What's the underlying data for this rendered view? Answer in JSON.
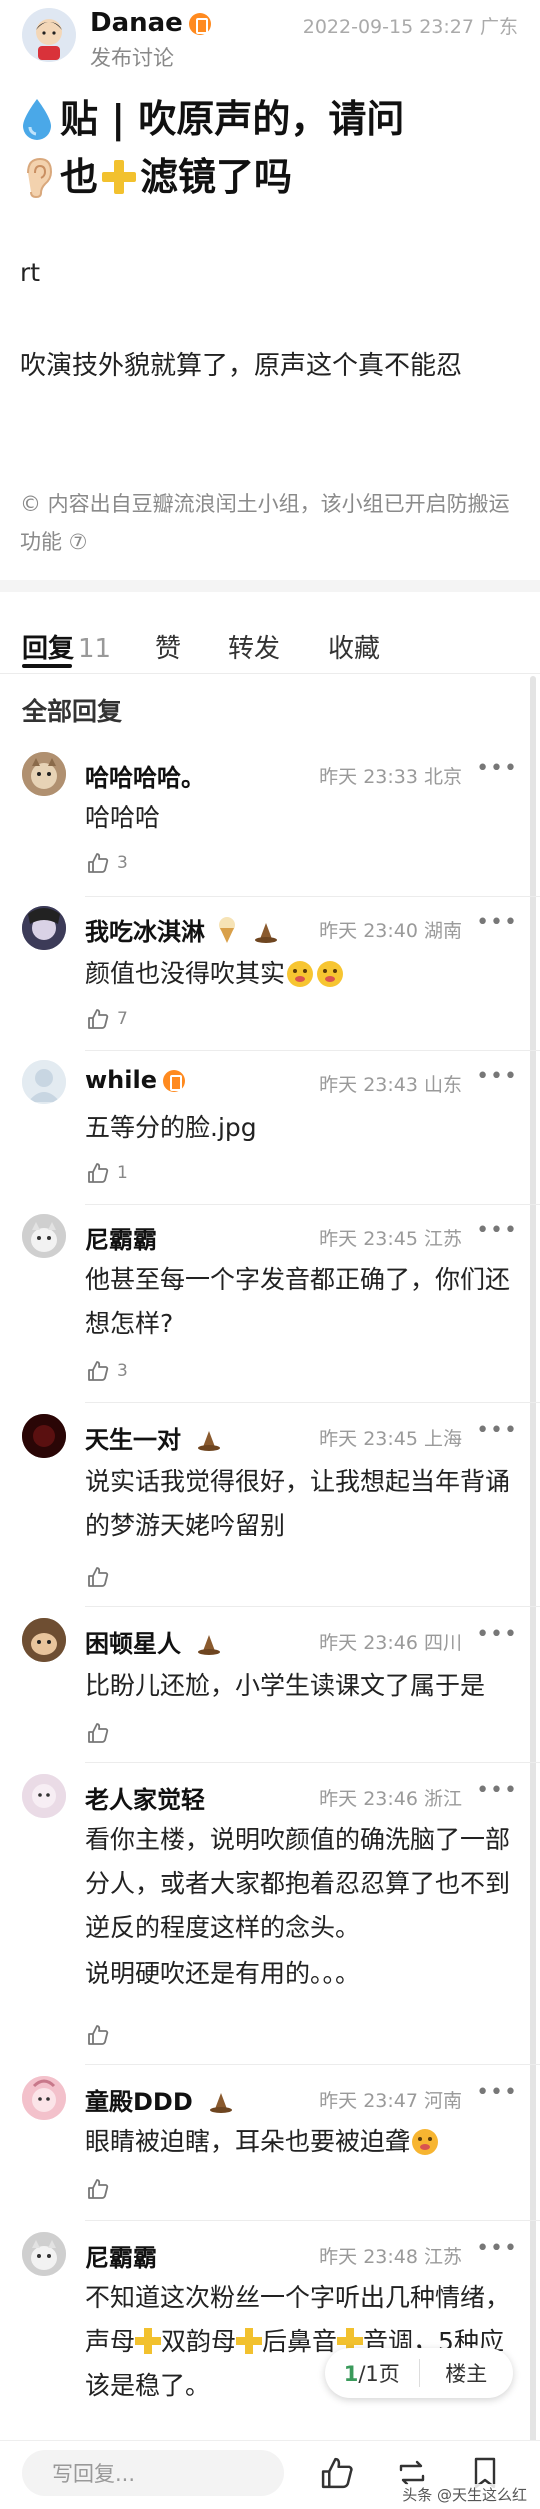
{
  "post": {
    "author": "Danae",
    "subtitle": "发布讨论",
    "timestamp": "2022-09-15 23:27 广东",
    "title_line1": "贴 | 吹原声的，请问",
    "title_line2_a": "也",
    "title_line2_b": "滤镜了吗",
    "body_p1": "rt",
    "body_p2": "吹演技外貌就算了，原声这个真不能忍",
    "source_note": "© 内容出自豆瓣流浪闰土小组，该小组已开启防搬运功能 ⑦"
  },
  "tabs": {
    "reply": "回复",
    "reply_count": "11",
    "like": "赞",
    "forward": "转发",
    "collect": "收藏"
  },
  "section_title": "全部回复",
  "comments": [
    {
      "name": "哈哈哈哈。",
      "meta": "昨天 23:33 北京",
      "text": "哈哈哈",
      "likes": "3"
    },
    {
      "name": "我吃冰淇淋",
      "meta": "昨天 23:40 湖南",
      "text": "颜值也没得吹其实",
      "likes": "7"
    },
    {
      "name": "while",
      "meta": "昨天 23:43 山东",
      "text": "五等分的脸.jpg",
      "likes": "1"
    },
    {
      "name": "尼霸霸",
      "meta": "昨天 23:45 江苏",
      "text": "他甚至每一个字发音都正确了，你们还想怎样?",
      "likes": "3"
    },
    {
      "name": "天生一对",
      "meta": "昨天 23:45 上海",
      "text": "说实话我觉得很好，让我想起当年背诵的梦游天姥吟留别",
      "likes": ""
    },
    {
      "name": "困顿星人",
      "meta": "昨天 23:46 四川",
      "text": "比盼儿还尬，小学生读课文了属于是",
      "likes": ""
    },
    {
      "name": "老人家觉轻",
      "meta": "昨天 23:46 浙江",
      "text": "看你主楼，说明吹颜值的确洗脑了一部分人，或者大家都抱着忍忍算了也不到逆反的程度这样的念头。",
      "text2": "说明硬吹还是有用的。。。",
      "likes": ""
    },
    {
      "name": "童殿DDD",
      "meta": "昨天 23:47 河南",
      "text": "眼睛被迫瞎，耳朵也要被迫聋",
      "likes": ""
    },
    {
      "name": "尼霸霸",
      "meta": "昨天 23:48 江苏",
      "text_a": "不知道这次粉丝一个字听出几种情绪，声母",
      "text_b": "双韵母",
      "text_c": "后鼻音",
      "text_d": "音调，5种应该是稳了。",
      "likes": ""
    }
  ],
  "pager": {
    "current": "1",
    "total": "/1页",
    "host": "楼主"
  },
  "bottom": {
    "placeholder": "写回复...",
    "watermark": "头条 @天生这么红"
  },
  "colors": {
    "accent_orange": "#ff8a1f",
    "pager_green": "#3a9a5b",
    "cross_yellow": "#f2c12e"
  }
}
